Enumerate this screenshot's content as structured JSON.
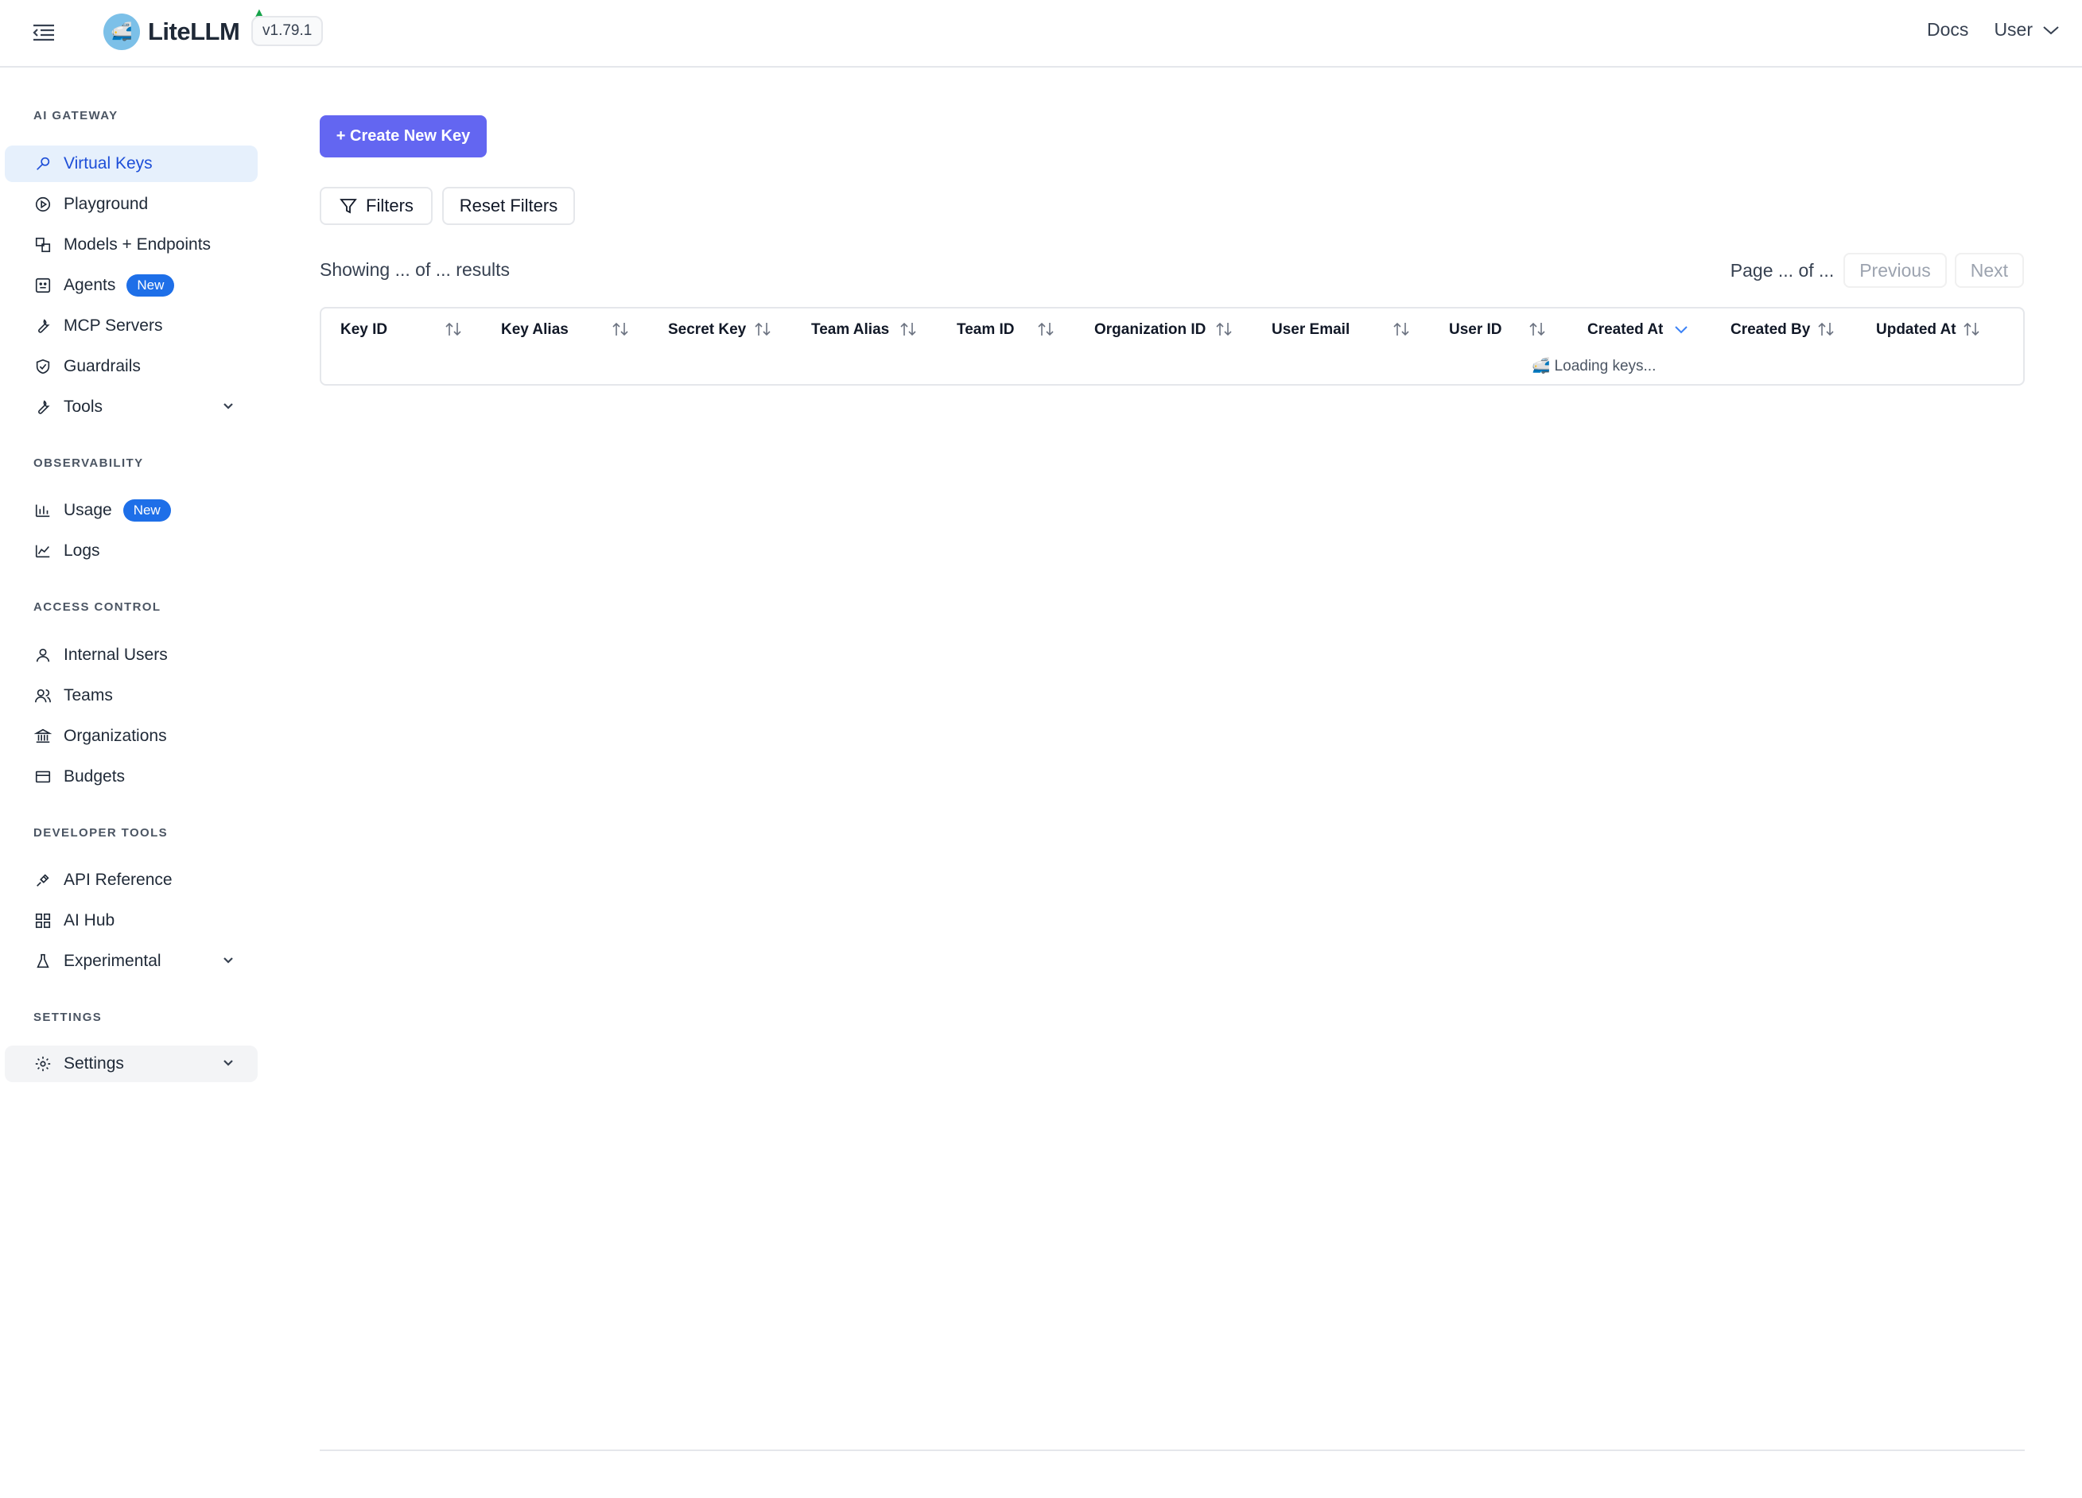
{
  "header": {
    "logo_text": "LiteLLM",
    "version": "v1.79.1",
    "docs": "Docs",
    "user": "User"
  },
  "sidebar": {
    "sections": {
      "ai_gateway": "AI GATEWAY",
      "observability": "OBSERVABILITY",
      "access_control": "ACCESS CONTROL",
      "developer_tools": "DEVELOPER TOOLS",
      "settings": "SETTINGS"
    },
    "items": {
      "virtual_keys": "Virtual Keys",
      "playground": "Playground",
      "models_endpoints": "Models + Endpoints",
      "agents": "Agents",
      "mcp_servers": "MCP Servers",
      "guardrails": "Guardrails",
      "tools": "Tools",
      "usage": "Usage",
      "logs": "Logs",
      "internal_users": "Internal Users",
      "teams": "Teams",
      "organizations": "Organizations",
      "budgets": "Budgets",
      "api_reference": "API Reference",
      "ai_hub": "AI Hub",
      "experimental": "Experimental",
      "settings": "Settings"
    },
    "badge_new": "New"
  },
  "main": {
    "create_button": "+ Create New Key",
    "filters_button": "Filters",
    "reset_filters_button": "Reset Filters",
    "showing": "Showing ... of ... results",
    "page_info": "Page ... of ...",
    "previous": "Previous",
    "next": "Next",
    "columns": [
      "Key ID",
      "Key Alias",
      "Secret Key",
      "Team Alias",
      "Team ID",
      "Organization ID",
      "User Email",
      "User ID",
      "Created At",
      "Created By",
      "Updated At"
    ],
    "loading": "🚅 Loading keys..."
  },
  "colors": {
    "accent": "#6366f1",
    "active_nav_bg": "#e6f0fc",
    "active_nav_text": "#1d4ed8",
    "badge": "#1e6fe8"
  }
}
